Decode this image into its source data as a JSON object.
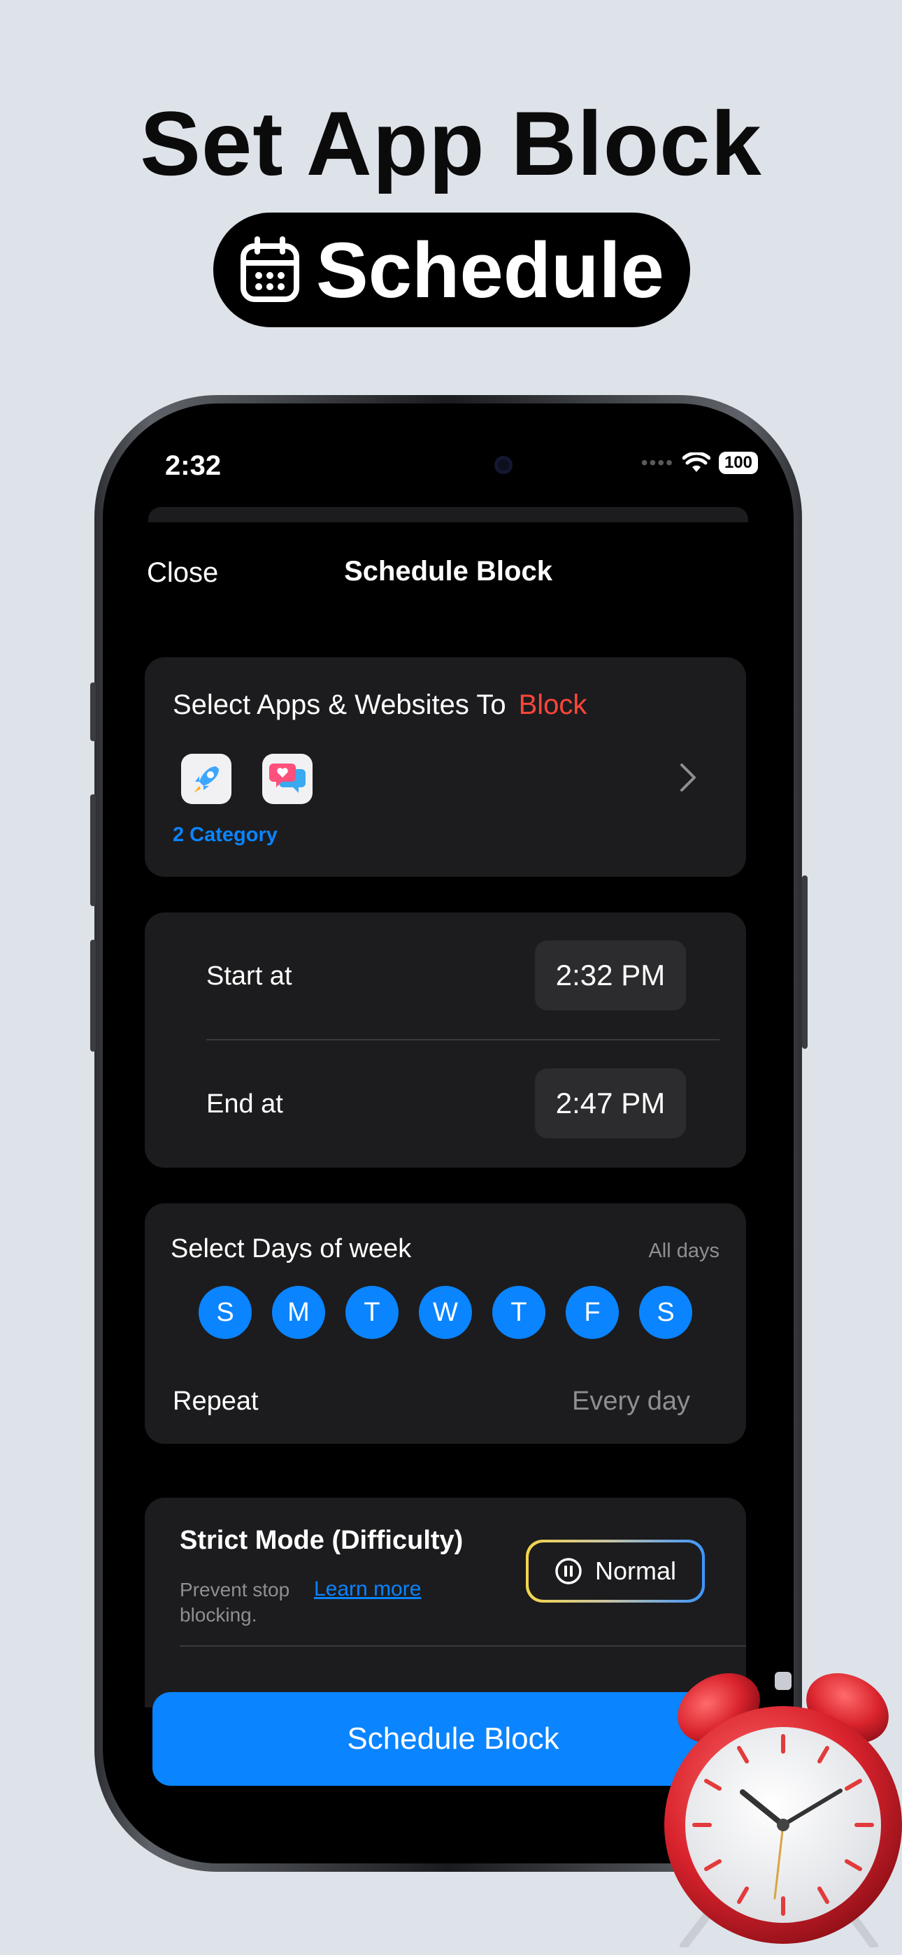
{
  "promo": {
    "headline": "Set App Block",
    "pill_label": "Schedule"
  },
  "status_bar": {
    "time": "2:32",
    "battery": "100"
  },
  "nav": {
    "close_label": "Close",
    "title": "Schedule Block"
  },
  "apps_card": {
    "title": "Select Apps & Websites To",
    "title_highlight": "Block",
    "category_count": "2 Category"
  },
  "time_card": {
    "start_label": "Start at",
    "start_value": "2:32 PM",
    "end_label": "End at",
    "end_value": "2:47 PM"
  },
  "days_card": {
    "title": "Select Days of week",
    "summary": "All days",
    "days": [
      "S",
      "M",
      "T",
      "W",
      "T",
      "F",
      "S"
    ],
    "repeat_label": "Repeat",
    "repeat_value": "Every day"
  },
  "strict_card": {
    "title": "Strict Mode (Difficulty)",
    "subtitle": "Prevent stop blocking.",
    "learn_more": "Learn more",
    "mode_label": "Normal"
  },
  "footer": {
    "schedule_button": "Schedule Block"
  },
  "colors": {
    "accent_blue": "#0a84ff",
    "block_red": "#ff453a",
    "card_bg": "#1c1c1e"
  }
}
